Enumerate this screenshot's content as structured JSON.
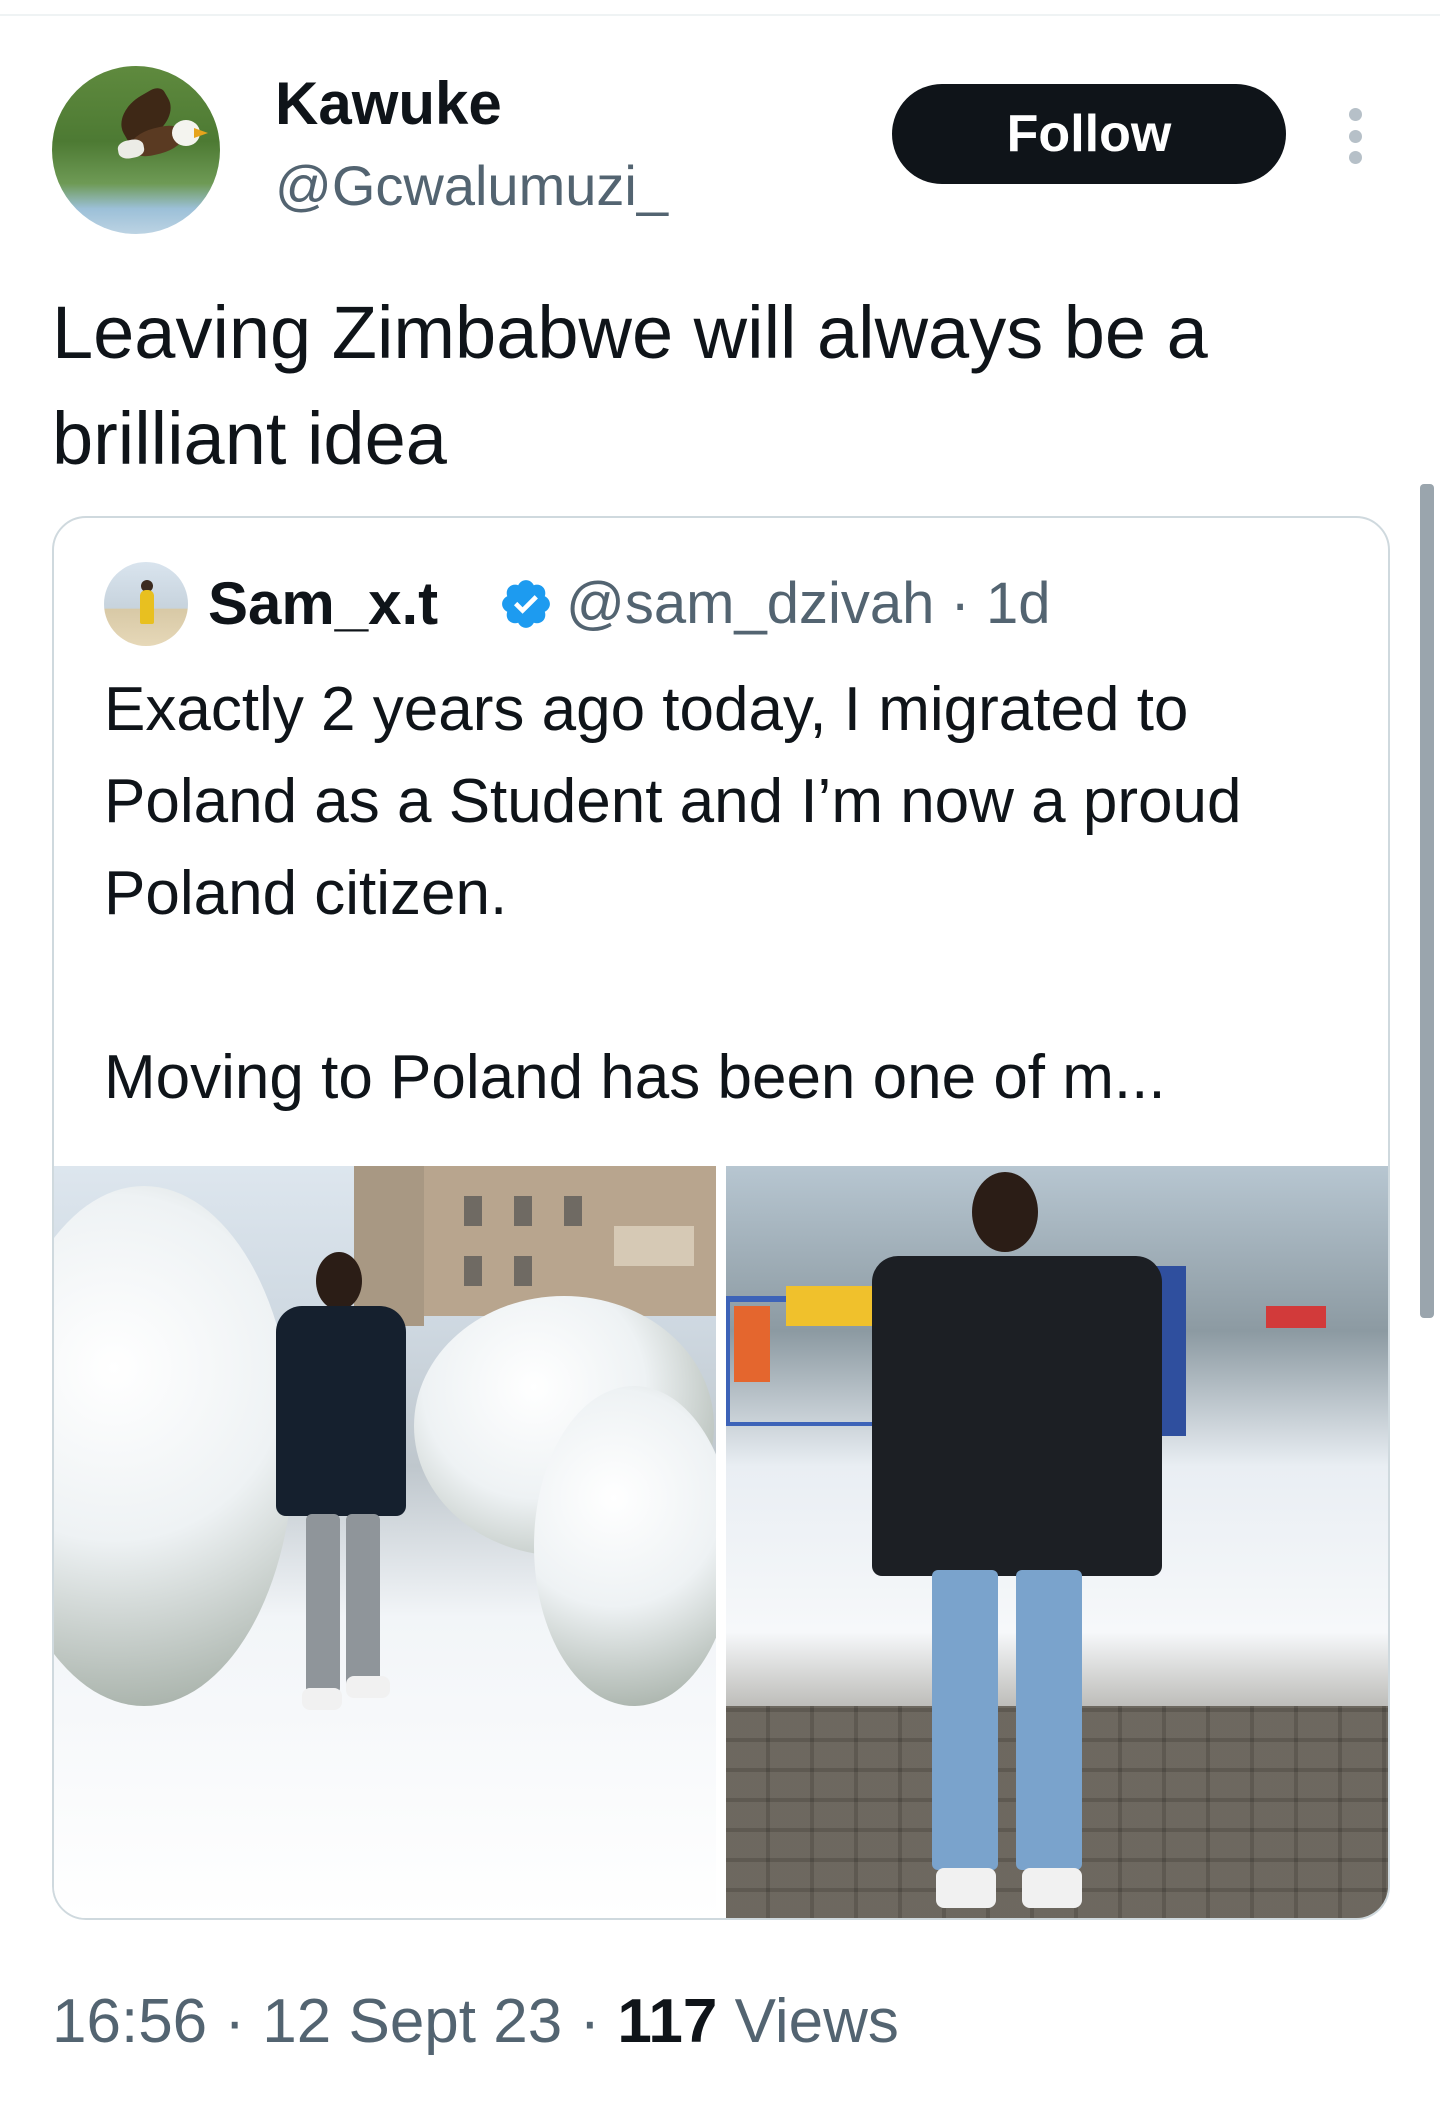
{
  "tweet": {
    "author_name": "Kawuke",
    "author_handle": "@Gcwalumuzi_",
    "follow_label": "Follow",
    "text": "Leaving Zimbabwe will always be a brilliant idea",
    "time": "16:56",
    "separator": "·",
    "date": "12 Sept 23",
    "views_count": "117",
    "views_label": "Views"
  },
  "quote": {
    "author_name": "Sam_x.t",
    "author_handle": "@sam_dzivah",
    "age": "1d",
    "text_line1": "Exactly 2 years ago today, I migrated to Poland as a Student and I’m now a proud Poland citizen.",
    "text_line2": "Moving to Poland has been one of m...",
    "verified": true,
    "verified_color": "#1d9bf0",
    "photos": [
      "photo-snowy-path",
      "photo-paved-courtyard"
    ]
  },
  "icons": {
    "more": "more-vertical-icon",
    "verified": "verified-badge-icon"
  }
}
